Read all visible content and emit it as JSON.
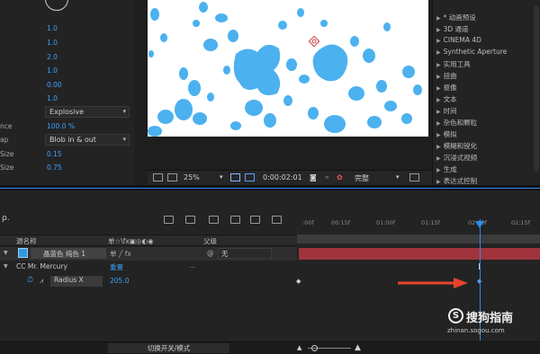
{
  "effect_controls": {
    "params": [
      {
        "name": "",
        "value": "1.0"
      },
      {
        "name": "",
        "value": "1.0"
      },
      {
        "name": "",
        "value": "2.0"
      },
      {
        "name": "",
        "value": "1.0"
      },
      {
        "name": "",
        "value": "0.00"
      },
      {
        "name": "",
        "value": "1.0"
      }
    ],
    "shape_dropdown": "Explosive",
    "influence": {
      "name": "nce",
      "value": "100.0 %"
    },
    "map": {
      "name": "ap",
      "value": "Blob in & out"
    },
    "size": {
      "name": "Size",
      "value": "0.15"
    },
    "size2": {
      "name": "Size",
      "value": "0.75"
    }
  },
  "viewer": {
    "zoom": "25%",
    "timecode": "0:00:02:01",
    "resolution": "完整"
  },
  "effects_list": [
    "* 动画预设",
    "3D 通道",
    "CINEMA 4D",
    "Synthetic Aperture",
    "实用工具",
    "扭曲",
    "抠像",
    "文本",
    "时间",
    "杂色和颗粒",
    "模拟",
    "模糊和锐化",
    "沉浸式视频",
    "生成",
    "表达式控制"
  ],
  "timeline": {
    "search_prefix": "ρ.",
    "headers": {
      "source_name": "源名称",
      "switches": "单☆\\fx▣◎◐◉",
      "parent": "父级"
    },
    "layers": [
      {
        "name": "晶蓝色 纯色 1",
        "parent": "无"
      },
      {
        "name": "CC Mr. Mercury",
        "value": "重置",
        "dots": "..."
      },
      {
        "name": "Radius X",
        "value": "205.0"
      }
    ],
    "ruler_ticks": [
      ":00f",
      "00:15f",
      "01:00f",
      "01:15f",
      "02:00f",
      "02:15f"
    ],
    "toggle_modes": "切换开关/模式"
  },
  "watermark": {
    "brand": "搜狗指南",
    "logo": "S",
    "url": "zhinan.sogou.com"
  },
  "colors": {
    "accent_blue": "#2d8ceb",
    "value_blue": "#3aa3ff",
    "track_red": "#a0343c",
    "layer_label": "#3399dd",
    "arrow_red": "#e8452c",
    "blob_blue": "#4cb1ef"
  }
}
